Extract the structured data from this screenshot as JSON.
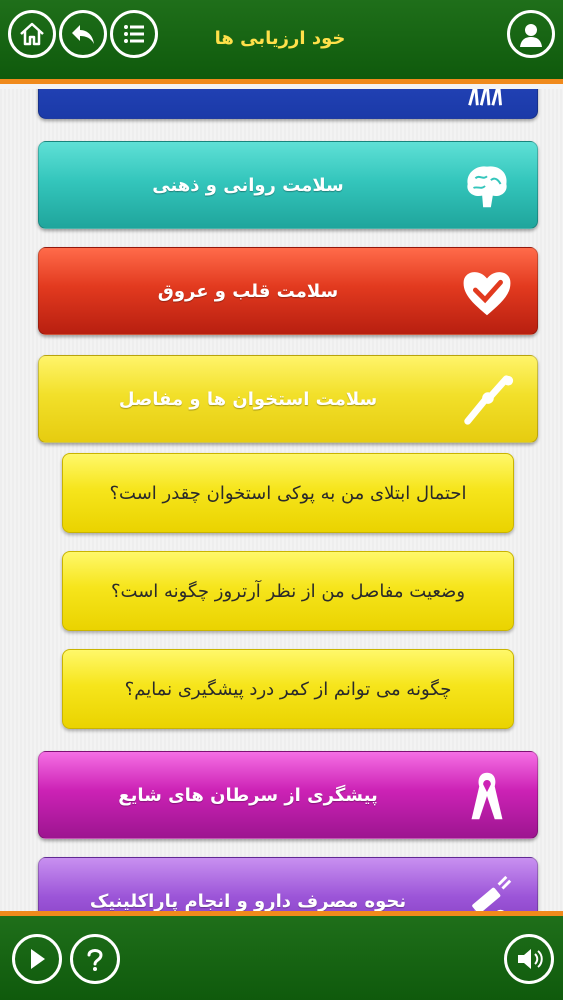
{
  "header": {
    "title": "خود ارزیابی ها",
    "icons": [
      "home-icon",
      "back-icon",
      "list-icon",
      "profile-icon"
    ]
  },
  "categories": [
    {
      "label": "",
      "icon": "hands-icon",
      "color": "#1b3aa8"
    },
    {
      "label": "سلامت روانی و ذهنی",
      "icon": "brain-icon",
      "color": "#34c6bc"
    },
    {
      "label": "سلامت قلب و عروق",
      "icon": "heart-check-icon",
      "color": "#e23a1f"
    },
    {
      "label": "سلامت استخوان ها و مفاصل",
      "icon": "bone-icon",
      "color": "#f2e02a"
    },
    {
      "label": "پیشگری از سرطان های شایع",
      "icon": "ribbon-icon",
      "color": "#cc22b5"
    },
    {
      "label": "نحوه مصرف دارو و انجام پاراکلینیک",
      "icon": "syringe-icon",
      "color": "#9c55d8"
    }
  ],
  "subitems": [
    {
      "label": "احتمال ابتلای من به پوکی استخوان چقدر است؟"
    },
    {
      "label": "وضعیت مفاصل من از نظر آرتروز چگونه است؟"
    },
    {
      "label": "چگونه می توانم از کمر درد پیشگیری نمایم؟"
    }
  ],
  "footer": {
    "icons": [
      "next-icon",
      "help-icon",
      "sound-icon"
    ]
  }
}
